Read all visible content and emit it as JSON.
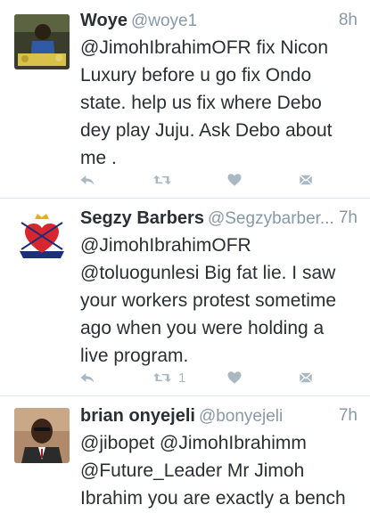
{
  "colors": {
    "text": "#292f33",
    "secondary": "#8899a6",
    "icon": "#aab8c2",
    "divider": "#e1e8ed"
  },
  "tweets": [
    {
      "name": "Woye",
      "handle": "@woye1",
      "time": "8h",
      "text": "@JimohIbrahimOFR fix Nicon Luxury before u go fix Ondo state. help us fix where Debo dey play Juju. Ask Debo about me .",
      "retweets": "",
      "icons": [
        "reply-icon",
        "retweet-icon",
        "like-icon",
        "dm-icon"
      ]
    },
    {
      "name": "Segzy Barbers",
      "handle": "@Segzybarber...",
      "time": "7h",
      "text": "@JimohIbrahimOFR @toluogunlesi Big fat lie. I saw your workers protest sometime ago when you were holding a live program.",
      "retweets": "1",
      "logo_text": [
        "SB",
        "SEGZY BARBERS"
      ],
      "icons": [
        "reply-icon",
        "retweet-icon",
        "like-icon",
        "dm-icon"
      ]
    },
    {
      "name": "brian onyejeli",
      "handle": "@bonyejeli",
      "time": "7h",
      "text": "@jibopet @JimohIbrahimm @Future_Leader Mr Jimoh Ibrahim you are exactly a bench",
      "retweets": "",
      "icons": []
    }
  ]
}
